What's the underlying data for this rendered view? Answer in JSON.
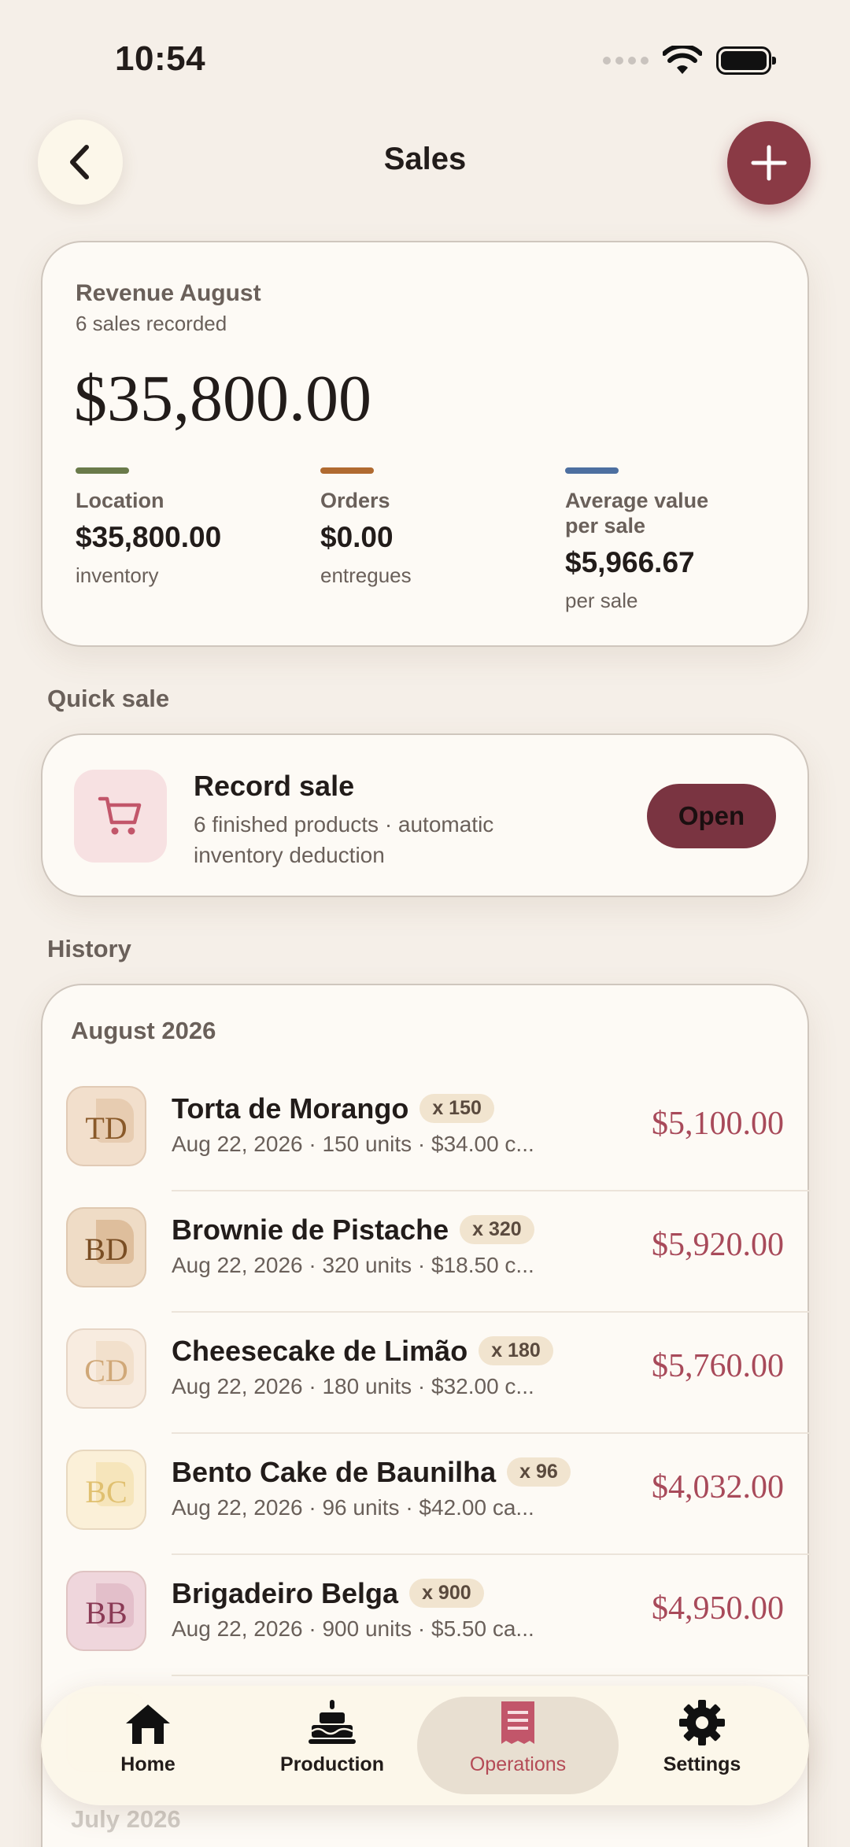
{
  "status_bar": {
    "time": "10:54"
  },
  "header": {
    "title": "Sales"
  },
  "revenue": {
    "label": "Revenue August",
    "subtitle": "6 sales recorded",
    "total": "$35,800.00",
    "metrics": [
      {
        "label": "Location",
        "value": "$35,800.00",
        "sub": "inventory",
        "color": "#6a7a4a"
      },
      {
        "label": "Orders",
        "value": "$0.00",
        "sub": "entregues",
        "color": "#b06a30"
      },
      {
        "label": "Average value per sale",
        "value": "$5,966.67",
        "sub": "per sale",
        "color": "#4d6fa0"
      }
    ]
  },
  "quick_sale": {
    "section_label": "Quick sale",
    "title": "Record sale",
    "description": "6 finished products · automatic inventory deduction",
    "button_label": "Open"
  },
  "history": {
    "section_label": "History",
    "month": "August 2026",
    "sales": [
      {
        "initials": "TD",
        "name": "Torta de Morango",
        "qty": "x 150",
        "meta": "Aug 22, 2026 · 150 units · $34.00 c...",
        "amount": "$5,100.00",
        "bg": "#f2dfcc",
        "fg": "#8a5a2a"
      },
      {
        "initials": "BD",
        "name": "Brownie de Pistache",
        "qty": "x 320",
        "meta": "Aug 22, 2026 · 320 units · $18.50 c...",
        "amount": "$5,920.00",
        "bg": "#efdcc6",
        "fg": "#7a4e24"
      },
      {
        "initials": "CD",
        "name": "Cheesecake de Limão",
        "qty": "x 180",
        "meta": "Aug 22, 2026 · 180 units · $32.00 c...",
        "amount": "$5,760.00",
        "bg": "#f8ece0",
        "fg": "#d0a878"
      },
      {
        "initials": "BC",
        "name": "Bento Cake de Baunilha",
        "qty": "x 96",
        "meta": "Aug 22, 2026 · 96 units · $42.00 ca...",
        "amount": "$4,032.00",
        "bg": "#fbf0d8",
        "fg": "#e0c070"
      },
      {
        "initials": "BB",
        "name": "Brigadeiro Belga",
        "qty": "x 900",
        "meta": "Aug 22, 2026 · 900 units · $5.50 ca...",
        "amount": "$4,950.00",
        "bg": "#efd6dc",
        "fg": "#8a3a55"
      }
    ],
    "next_month": "July 2026"
  },
  "tabbar": {
    "tabs": [
      {
        "label": "Home",
        "icon": "home-icon"
      },
      {
        "label": "Production",
        "icon": "cake-icon"
      },
      {
        "label": "Operations",
        "icon": "receipt-icon",
        "active": true
      },
      {
        "label": "Settings",
        "icon": "gear-icon"
      }
    ]
  }
}
